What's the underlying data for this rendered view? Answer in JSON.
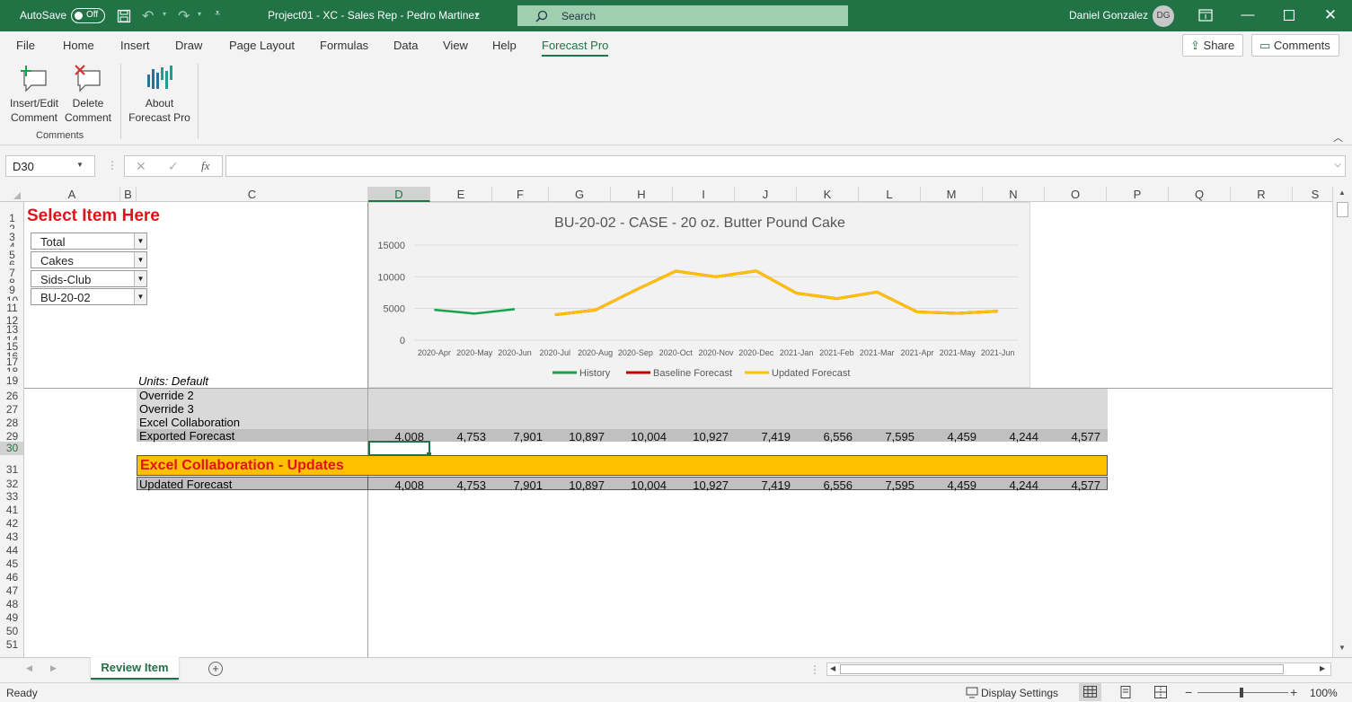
{
  "titlebar": {
    "autosave_label": "AutoSave",
    "autosave_state": "Off",
    "doc_title": "Project01 - XC - Sales Rep - Pedro Martinez",
    "search_placeholder": "Search",
    "user_name": "Daniel Gonzalez",
    "user_initials": "DG"
  },
  "menu": {
    "items": [
      "File",
      "Home",
      "Insert",
      "Draw",
      "Page Layout",
      "Formulas",
      "Data",
      "View",
      "Help",
      "Forecast Pro"
    ],
    "active": "Forecast Pro",
    "share_label": "Share",
    "comments_label": "Comments"
  },
  "ribbon": {
    "insert_edit": [
      "Insert/Edit",
      "Comment"
    ],
    "delete": [
      "Delete",
      "Comment"
    ],
    "about": [
      "About",
      "Forecast Pro"
    ],
    "group_label": "Comments"
  },
  "formula_bar": {
    "name_box": "D30",
    "fx": "fx",
    "formula": ""
  },
  "grid": {
    "columns": [
      "A",
      "B",
      "C",
      "D",
      "E",
      "F",
      "G",
      "H",
      "I",
      "J",
      "K",
      "L",
      "M",
      "N",
      "O",
      "P",
      "Q",
      "R",
      "S"
    ],
    "selected_column": "D",
    "rows": [
      "1",
      "2",
      "3",
      "4",
      "5",
      "6",
      "7",
      "8",
      "9",
      "10",
      "11",
      "12",
      "13",
      "14",
      "15",
      "16",
      "17",
      "18",
      "19",
      "26",
      "27",
      "28",
      "29",
      "30",
      "31",
      "32",
      "33",
      "41",
      "42",
      "43",
      "44",
      "45",
      "46",
      "47",
      "48",
      "49",
      "50",
      "51"
    ],
    "selected_row": "30"
  },
  "sheet": {
    "select_title": "Select Item Here",
    "dropdowns": [
      "Total",
      "Cakes",
      "Sids-Club",
      "BU-20-02"
    ],
    "units_label": "Units: Default",
    "override2": "Override 2",
    "override3": "Override 3",
    "excel_collab": "Excel Collaboration",
    "exported_label": "Exported Forecast",
    "exported_values": [
      "4,008",
      "4,753",
      "7,901",
      "10,897",
      "10,004",
      "10,927",
      "7,419",
      "6,556",
      "7,595",
      "4,459",
      "4,244",
      "4,577"
    ],
    "updates_header": "Excel Collaboration - Updates",
    "updated_label": "Updated Forecast",
    "updated_values": [
      "4,008",
      "4,753",
      "7,901",
      "10,897",
      "10,004",
      "10,927",
      "7,419",
      "6,556",
      "7,595",
      "4,459",
      "4,244",
      "4,577"
    ]
  },
  "chart_data": {
    "type": "line",
    "title": "BU-20-02 - CASE - 20 oz. Butter Pound Cake",
    "categories": [
      "2020-Apr",
      "2020-May",
      "2020-Jun",
      "2020-Jul",
      "2020-Aug",
      "2020-Sep",
      "2020-Oct",
      "2020-Nov",
      "2020-Dec",
      "2021-Jan",
      "2021-Feb",
      "2021-Mar",
      "2021-Apr",
      "2021-May",
      "2021-Jun"
    ],
    "yticks": [
      "15000",
      "10000",
      "5000",
      "0"
    ],
    "ylim": [
      0,
      15000
    ],
    "grid": true,
    "legend_position": "bottom",
    "series": [
      {
        "name": "History",
        "color": "#16a34a",
        "values": [
          4800,
          4200,
          4900,
          null,
          null,
          null,
          null,
          null,
          null,
          null,
          null,
          null,
          null,
          null,
          null
        ]
      },
      {
        "name": "Baseline Forecast",
        "color": "#c00000",
        "values": [
          null,
          null,
          null,
          4008,
          4753,
          7901,
          10897,
          10004,
          10927,
          7419,
          6556,
          7595,
          4459,
          4244,
          4577
        ]
      },
      {
        "name": "Updated Forecast",
        "color": "#ffc000",
        "values": [
          null,
          null,
          null,
          4008,
          4753,
          7901,
          10897,
          10004,
          10927,
          7419,
          6556,
          7595,
          4459,
          4244,
          4577
        ]
      }
    ]
  },
  "tabs": {
    "active": "Review Item",
    "add": "+"
  },
  "status": {
    "ready": "Ready",
    "display_settings": "Display Settings",
    "zoom": "100%"
  },
  "colors": {
    "excel_green": "#217346",
    "update_band": "#ffc000",
    "title_red": "#e0131b"
  }
}
